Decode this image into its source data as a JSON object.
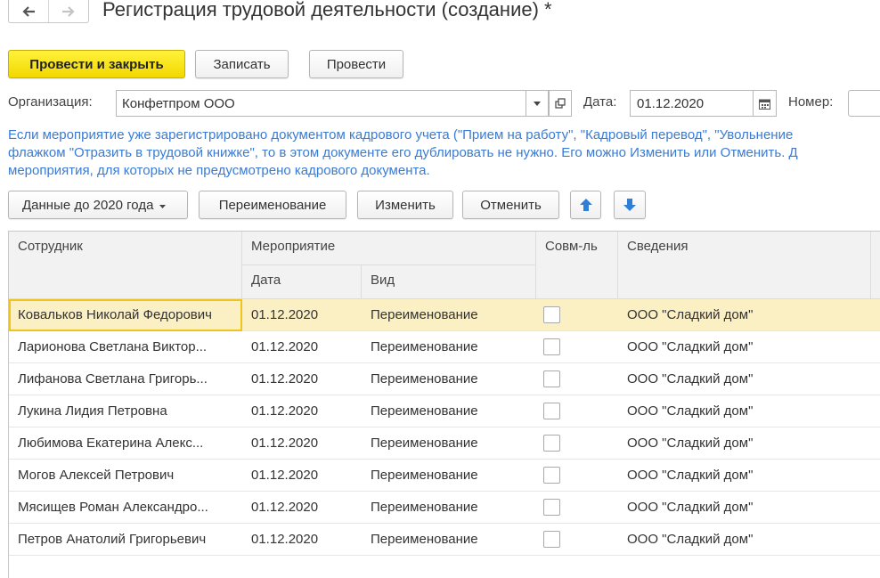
{
  "window": {
    "title": "Регистрация трудовой деятельности (создание) *"
  },
  "nav": {
    "back_icon": "arrow-left-icon",
    "forward_icon": "arrow-right-icon"
  },
  "toolbar": {
    "post_close": "Провести и закрыть",
    "save": "Записать",
    "post": "Провести"
  },
  "form": {
    "org_label": "Организация:",
    "org_value": "Конфетпром ООО",
    "date_label": "Дата:",
    "date_value": "01.12.2020",
    "number_label": "Номер:",
    "number_value": ""
  },
  "info": {
    "line1": "Если мероприятие уже зарегистрировано документом кадрового учета (\"Прием на работу\", \"Кадровый перевод\", \"Увольнение",
    "line2": "флажком \"Отразить в трудовой книжке\", то в этом документе его дублировать не нужно. Его можно Изменить или Отменить. Д",
    "line3": "мероприятия, для которых не предусмотрено кадрового документа."
  },
  "actions": {
    "data_before": "Данные до 2020 года",
    "rename": "Переименование",
    "change": "Изменить",
    "cancel": "Отменить"
  },
  "table": {
    "headers": {
      "employee": "Сотрудник",
      "event": "Мероприятие",
      "date": "Дата",
      "kind": "Вид",
      "combo": "Совм-ль",
      "details": "Сведения"
    },
    "rows": [
      {
        "employee": "Ковальков Николай Федорович",
        "date": "01.12.2020",
        "kind": "Переименование",
        "combo": false,
        "details": "ООО \"Сладкий дом\""
      },
      {
        "employee": "Ларионова Светлана Виктор...",
        "date": "01.12.2020",
        "kind": "Переименование",
        "combo": false,
        "details": "ООО \"Сладкий дом\""
      },
      {
        "employee": "Лифанова Светлана Григорь...",
        "date": "01.12.2020",
        "kind": "Переименование",
        "combo": false,
        "details": "ООО \"Сладкий дом\""
      },
      {
        "employee": "Лукина Лидия Петровна",
        "date": "01.12.2020",
        "kind": "Переименование",
        "combo": false,
        "details": "ООО \"Сладкий дом\""
      },
      {
        "employee": "Любимова Екатерина Алекс...",
        "date": "01.12.2020",
        "kind": "Переименование",
        "combo": false,
        "details": "ООО \"Сладкий дом\""
      },
      {
        "employee": "Могов Алексей Петрович",
        "date": "01.12.2020",
        "kind": "Переименование",
        "combo": false,
        "details": "ООО \"Сладкий дом\""
      },
      {
        "employee": "Мясищев Роман Александро...",
        "date": "01.12.2020",
        "kind": "Переименование",
        "combo": false,
        "details": "ООО \"Сладкий дом\""
      },
      {
        "employee": "Петров Анатолий Григорьевич",
        "date": "01.12.2020",
        "kind": "Переименование",
        "combo": false,
        "details": "ООО \"Сладкий дом\""
      }
    ]
  },
  "colors": {
    "accent_yellow": "#f2d800",
    "info_blue": "#3a7bd5",
    "selected_row": "#fbefc4",
    "move_arrow": "#2e7fd8"
  }
}
